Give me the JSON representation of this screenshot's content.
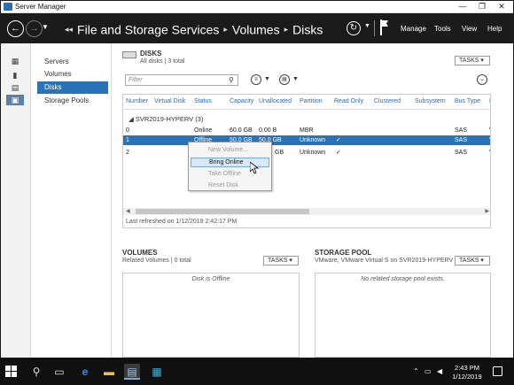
{
  "window": {
    "title": "Server Manager",
    "controls": [
      "—",
      "❐",
      "✕"
    ]
  },
  "header": {
    "breadcrumb": [
      "File and Storage Services",
      "Volumes",
      "Disks"
    ],
    "menu": [
      "Manage",
      "Tools",
      "View",
      "Help"
    ]
  },
  "leftbar": {
    "icons": [
      "dashboard-icon",
      "local-server-icon",
      "all-servers-icon",
      "file-storage-icon"
    ]
  },
  "nav": {
    "items": [
      "Servers",
      "Volumes",
      "Disks",
      "Storage Pools"
    ],
    "selected": "Disks"
  },
  "disks": {
    "title": "DISKS",
    "subtitle": "All disks | 3 total",
    "tasks": "TASKS",
    "filter_placeholder": "Filter",
    "columns": [
      "Number",
      "Virtual Disk",
      "Status",
      "Capacity",
      "Unallocated",
      "Partition",
      "Read Only",
      "Clustered",
      "Subsystem",
      "Bus Type",
      "N"
    ],
    "group": "SVR2019-HYPERV (3)",
    "rows": [
      {
        "number": "0",
        "virtual": "",
        "status": "Online",
        "capacity": "60.0 GB",
        "unallocated": "0.00 B",
        "partition": "MBR",
        "readonly": "",
        "bus": "SAS",
        "n": "V"
      },
      {
        "number": "1",
        "virtual": "",
        "status": "Offline",
        "capacity": "50.0 GB",
        "unallocated": "50.0 GB",
        "partition": "Unknown",
        "readonly": "✓",
        "bus": "SAS",
        "n": "V"
      },
      {
        "number": "2",
        "virtual": "",
        "status": "",
        "capacity": "",
        "unallocated": "GB",
        "partition": "Unknown",
        "readonly": "✓",
        "bus": "SAS",
        "n": "V"
      }
    ],
    "selected_row": 1,
    "last_refreshed": "Last refreshed on 1/12/2019 2:42:17 PM"
  },
  "context_menu": {
    "items": [
      {
        "label": "New Volume...",
        "enabled": false
      },
      {
        "label": "Bring Online",
        "enabled": true,
        "hover": true
      },
      {
        "label": "Take Offline",
        "enabled": false
      },
      {
        "label": "Reset Disk",
        "enabled": false
      }
    ]
  },
  "volumes": {
    "title": "VOLUMES",
    "subtitle": "Related Volumes | 0 total",
    "tasks": "TASKS",
    "message": "Disk is Offline"
  },
  "storage_pool": {
    "title": "STORAGE POOL",
    "subtitle": "VMware, VMware Virtual S on SVR2019-HYPERV",
    "tasks": "TASKS",
    "message": "No related storage pool exists."
  },
  "taskbar": {
    "time": "2:43 PM",
    "date": "1/12/2019"
  },
  "colors": {
    "header_bg": "#1b1b1b",
    "selection": "#2a73b8",
    "taskbar": "#101010"
  }
}
